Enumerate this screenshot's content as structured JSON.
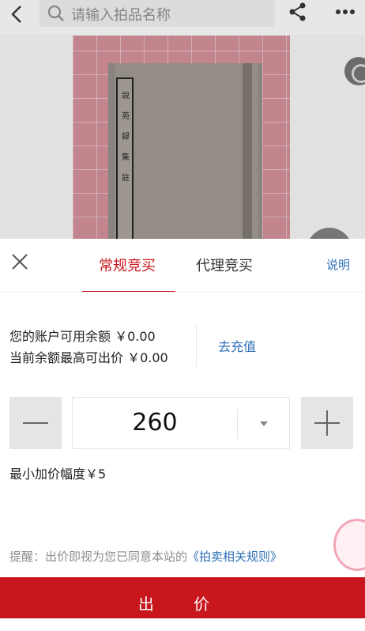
{
  "header": {
    "search_placeholder": "请输入拍品名称",
    "icons": [
      "back-arrow-icon",
      "search-icon",
      "share-icon",
      "more-dots-icon"
    ]
  },
  "photo": {
    "book_title_chars": [
      "說",
      "苑",
      "録",
      "集",
      "註"
    ]
  },
  "tabs": [
    {
      "label": "常规竞买",
      "active": true
    },
    {
      "label": "代理竞买",
      "active": false
    }
  ],
  "explain_label": "说明",
  "balance": {
    "available": "您的账户可用余额 ￥0.00",
    "max_bid": "当前余额最高可出价 ￥0.00",
    "recharge_label": "去充值"
  },
  "bid": {
    "amount": "260",
    "min_increment": "最小加价幅度￥5"
  },
  "notice": {
    "prefix": "提醒：出价即视为您已同意本站的",
    "rules_link": "《拍卖相关规则》"
  },
  "submit_label": "出 价",
  "colors": {
    "accent": "#c8161d",
    "link": "#2d6fb7"
  }
}
